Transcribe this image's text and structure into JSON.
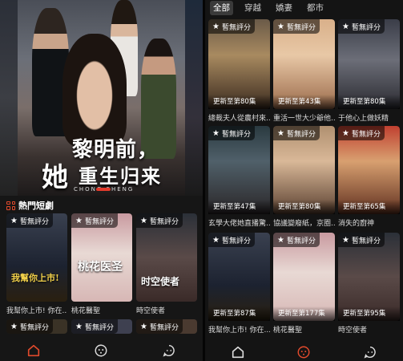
{
  "left_screen": {
    "hero": {
      "title_line1": "黎明前，",
      "title_line2": "她",
      "title_line3": "重生归来",
      "subtitle": "CHONG SHENG"
    },
    "section_title": "熱門短劇",
    "cards": [
      {
        "rating": "暫無評分",
        "title": "我幫你上市! 你在...",
        "poster_text": "我幫你上市!"
      },
      {
        "rating": "暫無評分",
        "title": "桃花醫聖",
        "poster_text": "桃花医圣"
      },
      {
        "rating": "暫無評分",
        "title": "時空使者",
        "poster_text": "时空使者"
      }
    ],
    "bottom_cards": [
      {
        "rating": "暫無評分"
      },
      {
        "rating": "暫無評分"
      },
      {
        "rating": "暫無評分"
      }
    ],
    "nav": [
      "home",
      "discover",
      "message"
    ]
  },
  "right_screen": {
    "tabs": [
      "全部",
      "穿越",
      "嬌妻",
      "都市"
    ],
    "rows": [
      [
        {
          "rating": "暫無評分",
          "episodes": "更新至第80集",
          "title": "總裁夫人從農村來..."
        },
        {
          "rating": "暫無評分",
          "episodes": "更新至第43集",
          "title": "重活一世大少爺他..."
        },
        {
          "rating": "暫無評分",
          "episodes": "更新至第80集",
          "title": "于他心上做妖精"
        }
      ],
      [
        {
          "rating": "暫無評分",
          "episodes": "更新至第47集",
          "title": "玄學大佬她直播驚..."
        },
        {
          "rating": "暫無評分",
          "episodes": "更新至第80集",
          "title": "協議變廢紙，京圈..."
        },
        {
          "rating": "暫無評分",
          "episodes": "更新至第65集",
          "title": "消失的廚神"
        }
      ],
      [
        {
          "rating": "暫無評分",
          "episodes": "更新至第87集",
          "title": "我幫你上市! 你在..."
        },
        {
          "rating": "暫無評分",
          "episodes": "更新至第177集",
          "title": "桃花醫聖"
        },
        {
          "rating": "暫無評分",
          "episodes": "更新至第95集",
          "title": "時空使者"
        }
      ]
    ]
  },
  "colors": {
    "accent": "#e24a2c",
    "background": "#141414"
  }
}
